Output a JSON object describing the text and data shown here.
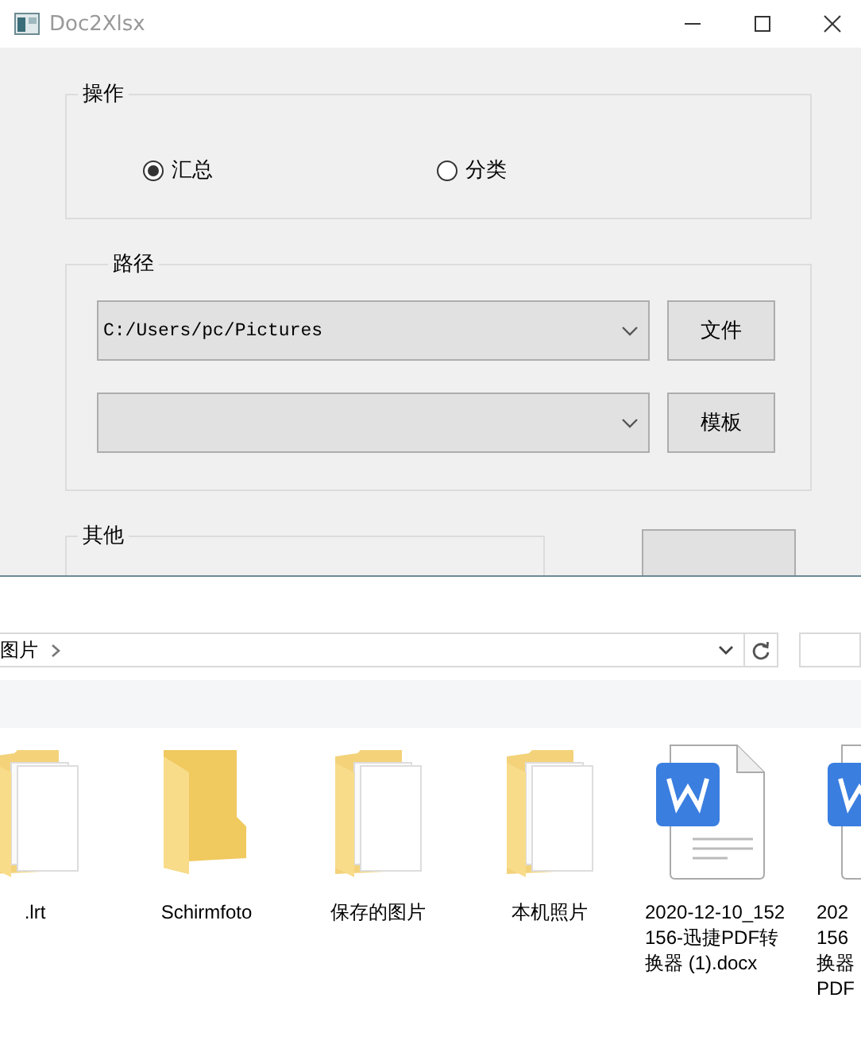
{
  "window": {
    "title": "Doc2Xlsx"
  },
  "operation_group": {
    "title": "操作",
    "options": [
      {
        "label": "汇总",
        "selected": true
      },
      {
        "label": "分类",
        "selected": false
      }
    ]
  },
  "path_group": {
    "title": "路径",
    "rows": [
      {
        "value": "C:/Users/pc/Pictures",
        "button": "文件"
      },
      {
        "value": "",
        "button": "模板"
      }
    ]
  },
  "other_group": {
    "title": "其他"
  },
  "explorer": {
    "breadcrumb": "图片",
    "items": [
      {
        "kind": "folder",
        "lines": [
          ".lrt"
        ]
      },
      {
        "kind": "empty-folder",
        "lines": [
          "Schirmfoto"
        ]
      },
      {
        "kind": "folder",
        "lines": [
          "保存的图片"
        ]
      },
      {
        "kind": "folder",
        "lines": [
          "本机照片"
        ]
      },
      {
        "kind": "docx",
        "lines": [
          "2020-12-10_152",
          "156-迅捷PDF转",
          "换器 (1).docx"
        ]
      },
      {
        "kind": "docx",
        "lines": [
          "202",
          "156",
          "换器",
          "PDF"
        ]
      }
    ]
  }
}
